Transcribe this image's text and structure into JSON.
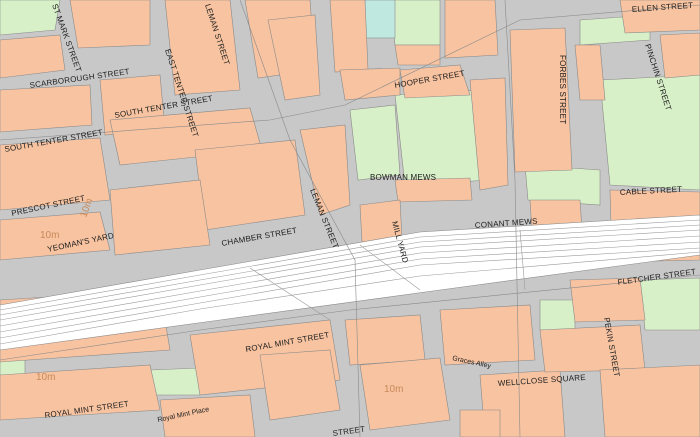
{
  "map": {
    "colors": {
      "road": "#c8c8c8",
      "building": "#f8c3a0",
      "green": "#d8f0c8",
      "rail_bg": "#ffffff",
      "rail_line": "#9a9a9a",
      "water": "#bfe8e0",
      "contour": "#c88a5a"
    },
    "street_labels": [
      "ST MARK STREET",
      "LEMAN STREET",
      "SCARBOROUGH STREET",
      "EAST TENTER STREET",
      "SOUTH TENTER STREET",
      "SOUTH TENTER STREET",
      "PRESCOT STREET",
      "YEOMAN'S YARD",
      "CHAMBER STREET",
      "LEMAN STREET",
      "HOOPER STREET",
      "BOWMAN MEWS",
      "MILL YARD",
      "CONANT MEWS",
      "FORBES STREET",
      "ELLEN STREET",
      "PINCHIN STREET",
      "CABLE STREET",
      "FLETCHER STREET",
      "PEKIN STREET",
      "ROYAL MINT STREET",
      "ROYAL MINT STREET",
      "Royal Mint Place",
      "Graces Alley",
      "WELLCLOSE SQUARE",
      "STREET"
    ],
    "contour_labels": [
      "10m",
      "10m",
      "10m",
      "10m"
    ]
  }
}
